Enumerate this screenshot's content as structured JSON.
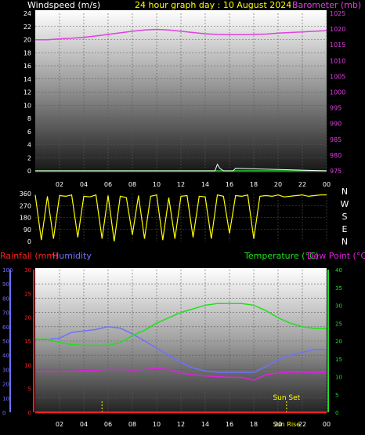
{
  "header": {
    "left_label": "Windspeed (m/s)",
    "title": "24 hour graph day : 10 August 2024",
    "right_label": "Barometer (mb)"
  },
  "colors": {
    "windspeed": "#ffffff",
    "barometer": "#e040e0",
    "direction": "#ffff00",
    "rainfall": "#ff2020",
    "humidity": "#7070ff",
    "temperature": "#20e020",
    "dewpoint": "#e020e0",
    "title": "#ffff00"
  },
  "x_ticks": [
    "02",
    "04",
    "06",
    "08",
    "10",
    "12",
    "14",
    "16",
    "18",
    "20",
    "22",
    "00"
  ],
  "top_panel": {
    "wind_ticks": [
      "0",
      "2",
      "4",
      "6",
      "8",
      "10",
      "12",
      "14",
      "16",
      "18",
      "20",
      "22",
      "24"
    ],
    "baro_ticks": [
      "975",
      "980",
      "985",
      "990",
      "995",
      "1000",
      "1005",
      "1010",
      "1015",
      "1020",
      "1025"
    ]
  },
  "dir_panel": {
    "ticks": [
      "0",
      "90",
      "180",
      "270",
      "360"
    ],
    "compass": [
      "N",
      "W",
      "S",
      "E",
      "N"
    ]
  },
  "bottom_panel": {
    "rain_label": "Rainfall (mm)",
    "humidity_label": "Humidity",
    "temp_label": "Temperature (°C)",
    "dew_label": "Dew Point (°C)",
    "humidity_ticks": [
      "0",
      "10",
      "20",
      "30",
      "40",
      "50",
      "60",
      "70",
      "80",
      "90",
      "100"
    ],
    "rain_ticks": [
      "0",
      "5",
      "10",
      "15",
      "20",
      "25",
      "30"
    ],
    "temp_ticks": [
      "0",
      "5",
      "10",
      "15",
      "20",
      "25",
      "30",
      "35",
      "40"
    ],
    "sunset_label": "Sun Set",
    "sunrise_label": "Sun Rise"
  },
  "chart_data": [
    {
      "type": "line",
      "x_unit": "hour",
      "x_range": [
        0,
        24
      ],
      "series": [
        {
          "name": "Windspeed (m/s)",
          "axis": "left",
          "ylim": [
            0,
            24
          ],
          "x": [
            0,
            14.8,
            15.0,
            15.2,
            15.5,
            16.3,
            16.5,
            24
          ],
          "values": [
            0,
            0,
            1.0,
            0.4,
            0,
            0,
            0.4,
            0
          ]
        },
        {
          "name": "Barometer (mb)",
          "axis": "right",
          "ylim": [
            975,
            1025
          ],
          "x": [
            0,
            1,
            2,
            3,
            4,
            5,
            6,
            7,
            8,
            9,
            10,
            11,
            12,
            13,
            14,
            15,
            16,
            17,
            18,
            19,
            20,
            21,
            22,
            23,
            24
          ],
          "values": [
            1016.6,
            1016.6,
            1016.9,
            1017.1,
            1017.4,
            1017.8,
            1018.3,
            1018.8,
            1019.3,
            1019.7,
            1019.9,
            1019.7,
            1019.3,
            1018.9,
            1018.5,
            1018.3,
            1018.2,
            1018.2,
            1018.3,
            1018.4,
            1018.7,
            1018.9,
            1019.1,
            1019.3,
            1019.5
          ]
        }
      ]
    },
    {
      "type": "line",
      "x_unit": "hour",
      "x_range": [
        0,
        24
      ],
      "series": [
        {
          "name": "Wind direction",
          "ylim": [
            0,
            360
          ],
          "x": [
            0,
            0.5,
            1.0,
            1.5,
            2.0,
            2.5,
            3.0,
            3.5,
            4.0,
            4.5,
            5.0,
            5.5,
            6.0,
            6.5,
            7.0,
            7.5,
            8.0,
            8.5,
            9.0,
            9.5,
            10.0,
            10.5,
            11.0,
            11.5,
            12.0,
            12.5,
            13.0,
            13.5,
            14.0,
            14.5,
            15.0,
            15.5,
            16.0,
            16.5,
            17.0,
            17.5,
            18.0,
            18.5,
            19.0,
            19.5,
            20.0,
            20.5,
            21.0,
            21.5,
            22.0,
            22.5,
            23.0,
            23.5,
            24.0
          ],
          "values": [
            350,
            10,
            340,
            20,
            345,
            340,
            350,
            30,
            340,
            335,
            350,
            20,
            345,
            0,
            340,
            330,
            50,
            345,
            20,
            340,
            350,
            10,
            330,
            20,
            340,
            345,
            30,
            340,
            335,
            20,
            350,
            340,
            60,
            345,
            340,
            350,
            20,
            340,
            345,
            340,
            350,
            335,
            340,
            345,
            350,
            340,
            345,
            350,
            350
          ]
        }
      ]
    },
    {
      "type": "line",
      "x_unit": "hour",
      "x_range": [
        0,
        24
      ],
      "series": [
        {
          "name": "Rainfall (mm)",
          "axis": "left-inner",
          "ylim": [
            0,
            30
          ],
          "x": [
            0,
            24
          ],
          "values": [
            0,
            0
          ]
        },
        {
          "name": "Humidity",
          "axis": "left",
          "ylim": [
            0,
            100
          ],
          "x": [
            0,
            1,
            2,
            3,
            4,
            5,
            6,
            7,
            8,
            9,
            10,
            11,
            12,
            13,
            14,
            15,
            16,
            17,
            18,
            19,
            20,
            21,
            22,
            23,
            24
          ],
          "values": [
            51,
            51,
            52,
            56,
            57,
            58,
            60,
            59,
            55,
            50,
            45,
            40,
            35,
            31,
            29,
            28,
            28,
            28,
            28,
            32,
            37,
            40,
            42,
            44,
            44
          ]
        },
        {
          "name": "Temperature (°C)",
          "axis": "right",
          "ylim": [
            0,
            40
          ],
          "x": [
            0,
            1,
            2,
            3,
            4,
            5,
            6,
            7,
            8,
            9,
            10,
            11,
            12,
            13,
            14,
            15,
            16,
            17,
            18,
            19,
            20,
            21,
            22,
            23,
            24
          ],
          "values": [
            20.5,
            20.5,
            19.5,
            19.0,
            18.8,
            18.8,
            18.8,
            19.5,
            21.5,
            23.0,
            25.0,
            26.5,
            28.0,
            29.0,
            30.0,
            30.5,
            30.5,
            30.5,
            30.0,
            28.5,
            26.5,
            25.0,
            24.0,
            23.5,
            23.5
          ]
        },
        {
          "name": "Dew Point (°C)",
          "axis": "right",
          "ylim": [
            0,
            40
          ],
          "x": [
            0,
            1,
            2,
            3,
            4,
            5,
            6,
            7,
            8,
            9,
            10,
            11,
            12,
            13,
            14,
            15,
            16,
            17,
            18,
            19,
            20,
            21,
            22,
            23,
            24
          ],
          "values": [
            11.5,
            11.5,
            11.5,
            11.5,
            11.7,
            11.8,
            12.0,
            12.0,
            11.8,
            12.0,
            12.3,
            12.0,
            11.0,
            10.5,
            10.2,
            10.0,
            9.8,
            9.8,
            9.0,
            10.5,
            11.0,
            11.2,
            11.3,
            11.0,
            11.2
          ]
        }
      ],
      "markers": {
        "sun_rise_hour": 5.5,
        "sun_set_hour": 20.7
      }
    }
  ]
}
